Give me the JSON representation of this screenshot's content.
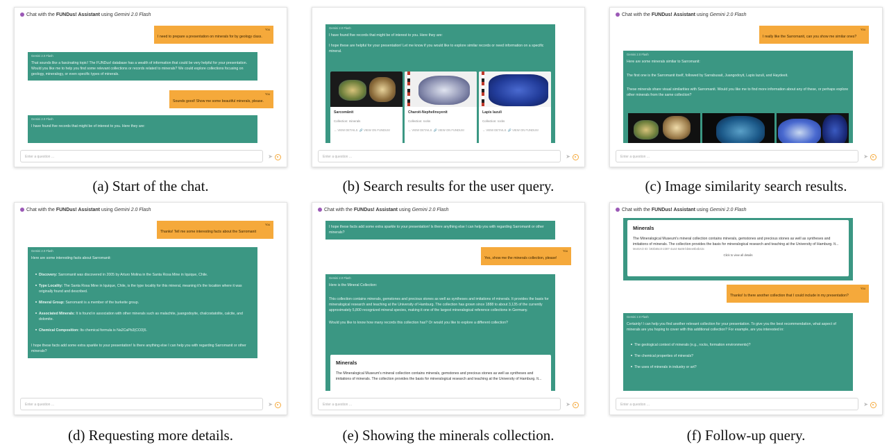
{
  "header": {
    "prefix": "Chat with the",
    "brand": "FUNDus! Assistant",
    "using": "using",
    "model": "Gemini 2.0 Flash"
  },
  "input_placeholder": "Enter a question ...",
  "labels": {
    "you": "You",
    "bot": "Gemini 2.0 Flash"
  },
  "panels": {
    "a": {
      "caption": "(a) Start of the chat.",
      "u1": "I need to prepare a presentation on minerals for by geology class.",
      "b1": "That sounds like a fascinating topic! The FUNDus! database has a wealth of information that could be very helpful for your presentation. Would you like me to help you find some relevant collections or records related to minerals? We could explore collections focusing on geology, mineralogy, or even specific types of minerals.",
      "u2": "Sounds good! Show me some beautiful minerals, please.",
      "b2": "I have found five records that might be of interest to you. Here they are:"
    },
    "b": {
      "caption": "(b) Search results for the user query.",
      "t1": "I have found five records that might be of interest to you. Here they are:",
      "t2": "I hope these are helpful for your presentation! Let me know if you would like to explore similar records or need information on a specific mineral.",
      "cards": [
        {
          "name": "Sarcomãnit",
          "collection": "Collection: minerals"
        },
        {
          "name": "Charoit-Nephelinsyenit",
          "collection": "Collection: rocks"
        },
        {
          "name": "Lapis lazuli",
          "collection": "Collection: rocks"
        }
      ],
      "view_details": "VIEW DETAILS",
      "view_fundus": "VIEW ON FUNDUS!"
    },
    "c": {
      "caption": "(c) Image similarity search results.",
      "u1": "I really like the Sarromanit, can you show me similar ones?",
      "t1": "Here are some minerals similar to Sarromanit:",
      "t2": "The first one is the Sarromanit itself, followed by Sarrabusait, Juangodoyit, Lapis lazuli, and Haydeeit.",
      "t3": "These minerals share visual similarities with Sarromanit. Would you like me to find more information about any of these, or perhaps explore other minerals from the same collection?"
    },
    "d": {
      "caption": "(d) Requesting more details.",
      "u1": "Thanks! Tell me some interesting facts about the Sarromanit",
      "intro": "Here are some interesting facts about Sarromanit:",
      "facts": [
        {
          "k": "Discovery:",
          "v": " Sarromanit was discovered in 2005 by Arturo Molina in the Santa Rosa Mine in Iquique, Chile."
        },
        {
          "k": "Type Locality:",
          "v": " The Santa Rosa Mine in Iquique, Chile, is the type locality for this mineral, meaning it's the location where it was originally found and described."
        },
        {
          "k": "Mineral Group:",
          "v": " Sarromanit is a member of the burkeite group."
        },
        {
          "k": "Associated Minerals:",
          "v": " It is found in association with other minerals such as malachite, juangodoyite, chalcostatolite, calcite, and dolomite."
        },
        {
          "k": "Chemical Composition:",
          "v": " Its chemical formula is Na2CaPb3(CO3)5."
        }
      ],
      "outro": "I hope these facts add some extra sparkle to your presentation! Is there anything else I can help you with regarding Sarromanit or other minerals?"
    },
    "e": {
      "caption": "(e) Showing the minerals collection.",
      "b0": "I hope these facts add some extra sparkle to your presentation! Is there anything else I can help you with regarding Sarromanit or other minerals?",
      "u1": "Yes, show me the minerals collection, please!",
      "t1": "Here is the Mineral Collection:",
      "t2": "This collection contains minerals, gemstones and precious stones as well as syntheses and imitations of minerals. It provides the basis for mineralogical research and teaching at the University of Hamburg. The collection has grown since 1888 to about 3,135 of the currently approximately 5,800 recognized mineral species, making it one of the largest mineralogical reference collections in Germany.",
      "t3": "Would you like to know how many records this collection has? Or would you like to explore a different collection?",
      "card_title": "Minerals",
      "card_text": "The Mineralogical Museum's mineral collection contains minerals, gemstones and precious stones as well as syntheses and imitations of minerals. The collection provides the basis for mineralogical research and teaching at the University of Hamburg. It..."
    },
    "f": {
      "caption": "(f) Follow-up query.",
      "card_title": "Minerals",
      "card_text": "The Mineralogical Museum's mineral collection contains minerals, gemstones and precious stones as well as syntheses and imitations of minerals. The collection provides the basis for mineralogical research and teaching at the University of Hamburg. It...",
      "card_id": "MoISAO ID: b93b65c0-2387-4a44-8a86-bb8ee8b4b42c",
      "card_link": "Click to view all details",
      "u1": "Thanks! Is there another collection that I could include in my presentation?",
      "t1": "Certainly! I can help you find another relevant collection for your presentation. To give you the best recommendation, what aspect of minerals are you hoping to cover with this additional collection? For example, are you interested in:",
      "items": [
        "The geological context of minerals (e.g., rocks, formation environments)?",
        "The chemical properties of minerals?",
        "The uses of minerals in industry or art?"
      ]
    }
  }
}
